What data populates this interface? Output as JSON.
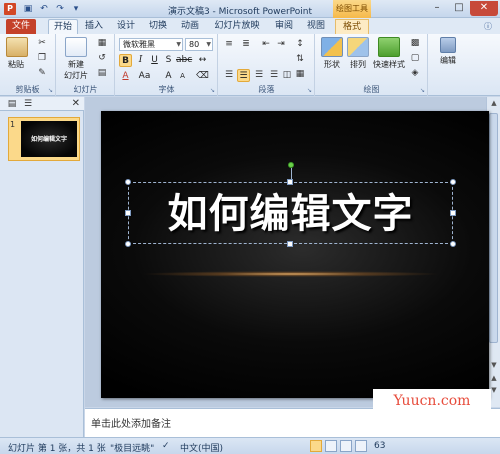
{
  "titlebar": {
    "app_icon": "P",
    "title": "演示文稿3 - Microsoft PowerPoint",
    "context_tab_title": "绘图工具"
  },
  "tabs": [
    {
      "id": "file",
      "label": "文件"
    },
    {
      "id": "home",
      "label": "开始"
    },
    {
      "id": "insert",
      "label": "插入"
    },
    {
      "id": "design",
      "label": "设计"
    },
    {
      "id": "transitions",
      "label": "切换"
    },
    {
      "id": "animations",
      "label": "动画"
    },
    {
      "id": "slideshow",
      "label": "幻灯片放映"
    },
    {
      "id": "review",
      "label": "审阅"
    },
    {
      "id": "view",
      "label": "视图"
    },
    {
      "id": "format",
      "label": "格式"
    }
  ],
  "ribbon": {
    "clipboard": {
      "paste": "粘贴",
      "label": "剪贴板"
    },
    "slides": {
      "new_slide_line1": "新建",
      "new_slide_line2": "幻灯片",
      "label": "幻灯片"
    },
    "font": {
      "font_name": "微软雅黑",
      "font_size": "80",
      "label": "字体"
    },
    "paragraph": {
      "label": "段落"
    },
    "drawing": {
      "shapes": "形状",
      "arrange": "排列",
      "quick_styles": "快速样式",
      "label": "绘图"
    },
    "editing": {
      "edit": "编辑"
    }
  },
  "slides_panel": {
    "thumb_number": "1",
    "thumb_text": "如何编辑文字"
  },
  "slide": {
    "title_text": "如何编辑文字"
  },
  "notes": {
    "placeholder": "单击此处添加备注"
  },
  "watermark": "Yuucn.com",
  "statusbar": {
    "slide_info": "幻灯片 第 1 张，共 1 张",
    "theme": "\"极目远眺\"",
    "language": "中文(中国)",
    "zoom": "63"
  },
  "colors": {
    "file_tab": "#c4412a",
    "context_tab": "#f6b94a",
    "slide_bg": "#000000",
    "selection_handle_rotate": "#6cd04a",
    "watermark_text": "#e74c3c"
  }
}
